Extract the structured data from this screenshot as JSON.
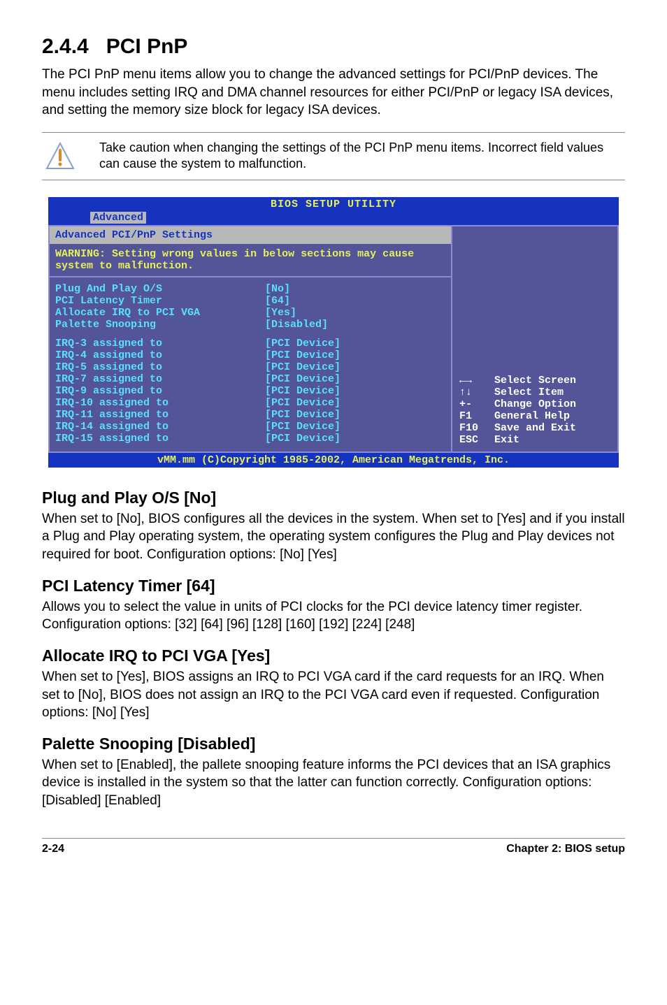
{
  "section": {
    "number": "2.4.4",
    "title": "PCI PnP",
    "intro": "The PCI PnP menu items allow you to change the advanced settings for PCI/PnP devices. The menu includes setting IRQ and DMA channel resources for either PCI/PnP or legacy ISA devices, and setting the memory size block for legacy ISA devices."
  },
  "note": "Take caution when changing the settings of the PCI PnP menu items. Incorrect field values can cause the system to malfunction.",
  "bios": {
    "header_title": "BIOS SETUP UTILITY",
    "tab_active": "Advanced",
    "section_title": "Advanced PCI/PnP Settings",
    "warning_label": "WARNING:",
    "warning_text": "Setting wrong values in below sections may cause system to malfunction.",
    "settings_top": [
      {
        "label": "Plug And Play O/S",
        "value": "[No]"
      },
      {
        "label": "PCI Latency Timer",
        "value": "[64]"
      },
      {
        "label": "Allocate IRQ to PCI VGA",
        "value": "[Yes]"
      },
      {
        "label": "Palette Snooping",
        "value": "[Disabled]"
      }
    ],
    "settings_irq": [
      {
        "label": "IRQ-3 assigned to",
        "value": "[PCI Device]"
      },
      {
        "label": "IRQ-4 assigned to",
        "value": "[PCI Device]"
      },
      {
        "label": "IRQ-5 assigned to",
        "value": "[PCI Device]"
      },
      {
        "label": "IRQ-7 assigned to",
        "value": "[PCI Device]"
      },
      {
        "label": "IRQ-9 assigned to",
        "value": "[PCI Device]"
      },
      {
        "label": "IRQ-10 assigned to",
        "value": "[PCI Device]"
      },
      {
        "label": "IRQ-11 assigned to",
        "value": "[PCI Device]"
      },
      {
        "label": "IRQ-14 assigned to",
        "value": "[PCI Device]"
      },
      {
        "label": "IRQ-15 assigned to",
        "value": "[PCI Device]"
      }
    ],
    "legend": [
      {
        "key": "←→",
        "desc": "Select Screen"
      },
      {
        "key": "↑↓",
        "desc": "Select Item"
      },
      {
        "key": "+-",
        "desc": "Change Option"
      },
      {
        "key": "F1",
        "desc": "General Help"
      },
      {
        "key": "F10",
        "desc": "Save and Exit"
      },
      {
        "key": "ESC",
        "desc": "Exit"
      }
    ],
    "footer": "vMM.mm (C)Copyright 1985-2002, American Megatrends, Inc."
  },
  "options": [
    {
      "title": "Plug and Play O/S [No]",
      "desc": "When set to [No], BIOS configures all the devices in the system. When set to [Yes] and if you install a Plug and Play operating system, the operating system configures the Plug and Play devices not required for boot. Configuration options: [No] [Yes]"
    },
    {
      "title": "PCI Latency Timer [64]",
      "desc": "Allows you to select the value in units of PCI clocks for the PCI device latency timer register. Configuration options: [32] [64] [96] [128] [160] [192] [224] [248]"
    },
    {
      "title": "Allocate IRQ to PCI VGA [Yes]",
      "desc": "When set to [Yes], BIOS assigns an IRQ to PCI VGA card if the card requests for an IRQ. When set to [No], BIOS does not assign an IRQ to the PCI VGA card even if requested. Configuration options: [No] [Yes]"
    },
    {
      "title": "Palette Snooping [Disabled]",
      "desc": "When set to [Enabled], the pallete snooping feature informs the PCI devices that an ISA graphics device is installed in the system so that the latter can function correctly. Configuration options: [Disabled] [Enabled]"
    }
  ],
  "footer": {
    "left": "2-24",
    "right": "Chapter 2: BIOS setup"
  }
}
